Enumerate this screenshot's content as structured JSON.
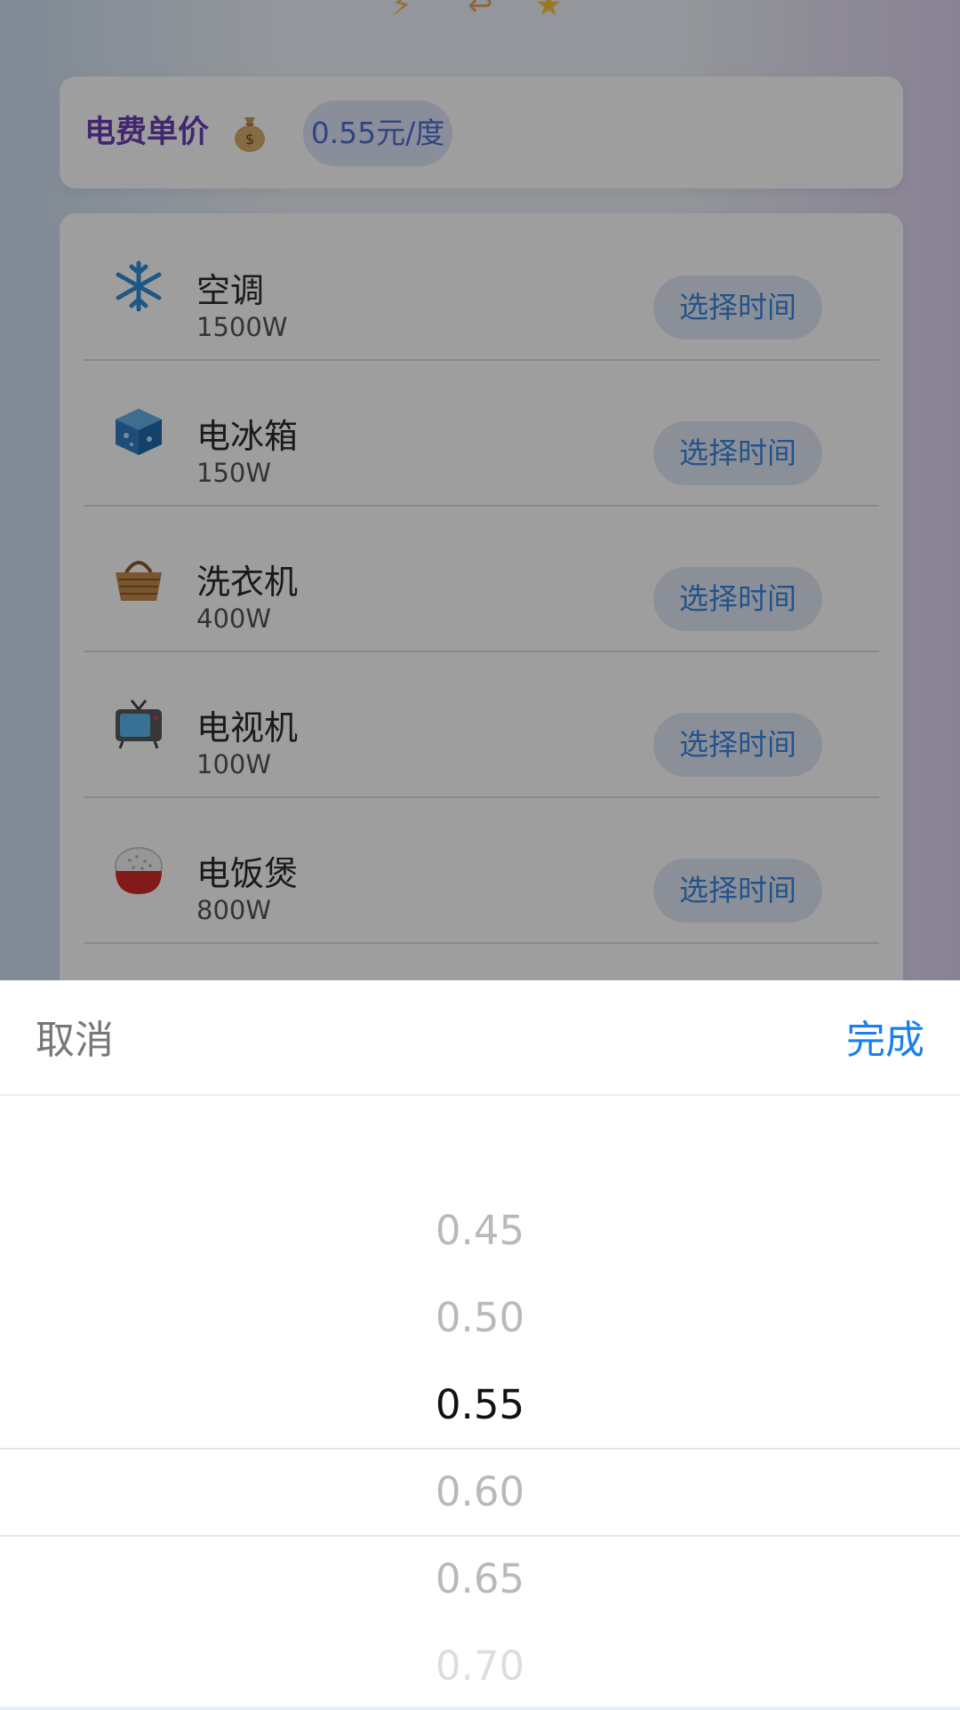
{
  "price": {
    "label": "电费单价",
    "icon": "money-bag-icon",
    "value": "0.55元/度"
  },
  "appliances": [
    {
      "name": "空调",
      "power": "1500W",
      "icon": "snowflake-icon",
      "button": "选择时间"
    },
    {
      "name": "电冰箱",
      "power": "150W",
      "icon": "ice-cube-icon",
      "button": "选择时间"
    },
    {
      "name": "洗衣机",
      "power": "400W",
      "icon": "basket-icon",
      "button": "选择时间"
    },
    {
      "name": "电视机",
      "power": "100W",
      "icon": "television-icon",
      "button": "选择时间"
    },
    {
      "name": "电饭煲",
      "power": "800W",
      "icon": "rice-bowl-icon",
      "button": "选择时间"
    }
  ],
  "sheet": {
    "cancel_label": "取消",
    "done_label": "完成",
    "options": [
      "0.45",
      "0.50",
      "0.55",
      "0.60",
      "0.65",
      "0.70"
    ],
    "selected": "0.55"
  },
  "colors": {
    "accent": "#1a7ff0",
    "price_label": "#6a3fb5",
    "button_text": "#3a86e0"
  }
}
